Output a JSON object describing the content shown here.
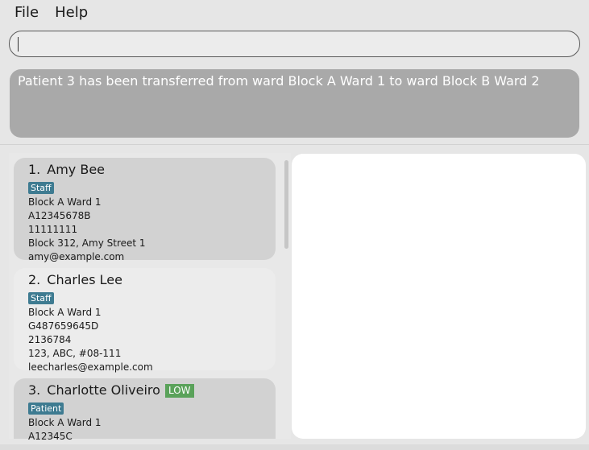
{
  "menu": {
    "file_label": "File",
    "help_label": "Help"
  },
  "command": {
    "value": "",
    "placeholder": ""
  },
  "result": {
    "message": "Patient 3 has been transferred from ward Block A Ward 1 to ward Block B Ward 2"
  },
  "persons": [
    {
      "index": "1.",
      "name": "Amy Bee",
      "role": "Staff",
      "ward": "Block A Ward 1",
      "nric": "A12345678B",
      "phone": "11111111",
      "address": "Block 312, Amy Street 1",
      "email": "amy@example.com"
    },
    {
      "index": "2.",
      "name": "Charles Lee",
      "role": "Staff",
      "ward": "Block A Ward 1",
      "nric": "G487659645D",
      "phone": "2136784",
      "address": "123, ABC, #08-111",
      "email": "leecharles@example.com"
    },
    {
      "index": "3.",
      "name": "Charlotte Oliveiro",
      "risk": "LOW",
      "role": "Patient",
      "ward": "Block A Ward 1",
      "nric": "A12345C"
    }
  ],
  "colors": {
    "staff_tag": "#3e7b91",
    "risk_low": "#5aa25a",
    "result_bg": "#a9a9a9"
  }
}
